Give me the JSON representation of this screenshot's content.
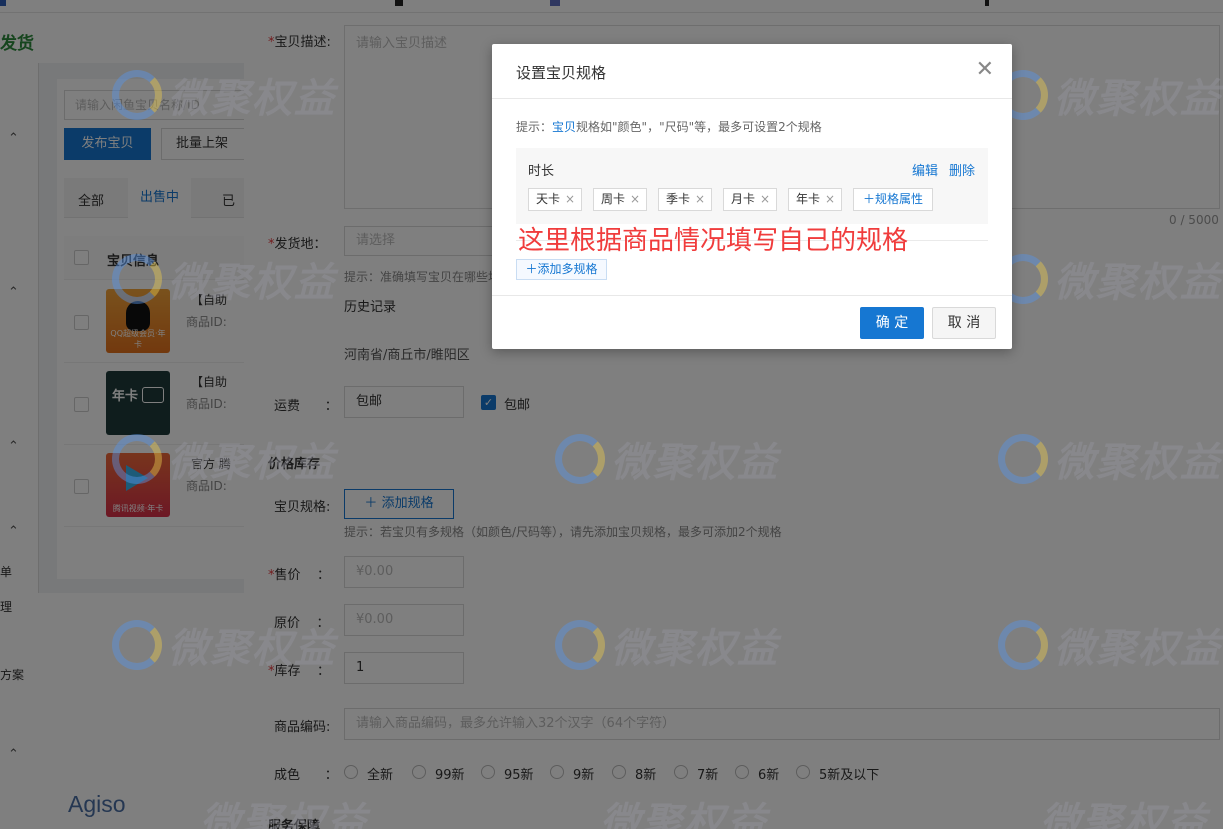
{
  "left": {
    "brand": "发货",
    "nav_labels": [
      "单",
      "理",
      "方案"
    ],
    "logo": "Agiso",
    "search_placeholder": "请输入闲鱼宝贝名称/ID",
    "publish_button": "发布宝贝",
    "batch_button": "批量上架",
    "tabs": [
      "全部",
      "出售中",
      "已"
    ],
    "table_header": "宝贝信息",
    "products": [
      {
        "title": "【自助",
        "id_label": "商品ID:",
        "thumb_caption": "QQ超级会员·年卡"
      },
      {
        "title": "【自助",
        "id_label": "商品ID:",
        "thumb_caption": "年卡"
      },
      {
        "title": "官方 腾",
        "id_label": "商品ID:",
        "thumb_caption": "腾讯视频·年卡"
      }
    ]
  },
  "form": {
    "desc_label": "宝贝描述:",
    "desc_placeholder": "请输入宝贝描述",
    "desc_counter": "0 / 5000",
    "ship_label": "发货地",
    "ship_placeholder": "请选择",
    "ship_tip": "提示：准确填写宝贝在哪些地",
    "history_label": "历史记录",
    "history_address": "河南省/商丘市/睢阳区",
    "freight_label": "运费",
    "freight_value": "包邮",
    "free_ship_label": "包邮",
    "price_section": "价格库存",
    "spec_label": "宝贝规格:",
    "add_spec_button": "添加规格",
    "spec_tip": "提示：若宝贝有多规格（如颜色/尺码等），请先添加宝贝规格，最多可添加2个规格",
    "price_label": "售价",
    "price_placeholder": "¥0.00",
    "orig_label": "原价",
    "orig_placeholder": "¥0.00",
    "stock_label": "库存",
    "stock_value": "1",
    "code_label": "商品编码:",
    "code_placeholder": "请输入商品编码，最多允许输入32个汉字（64个字符）",
    "condition_label": "成色",
    "conditions": [
      "全新",
      "99新",
      "95新",
      "9新",
      "8新",
      "7新",
      "6新",
      "5新及以下"
    ],
    "service_section": "服务保障"
  },
  "watermark_text": "微聚权益",
  "modal": {
    "title": "设置宝贝规格",
    "tip_prefix": "提示：",
    "tip_link": "宝贝",
    "tip_rest": "规格如\"颜色\"，\"尺码\"等，最多可设置2个规格",
    "spec_name": "时长",
    "edit": "编辑",
    "delete": "删除",
    "tags": [
      "天卡",
      "周卡",
      "季卡",
      "月卡",
      "年卡"
    ],
    "add_attr": "规格属性",
    "annotation": "这里根据商品情况填写自己的规格",
    "add_multi": "添加多规格",
    "ok": "确 定",
    "cancel": "取 消"
  },
  "colors": {
    "primary": "#1677d2",
    "annotation": "#f03c3c",
    "brand_green": "#2c8a3c"
  }
}
